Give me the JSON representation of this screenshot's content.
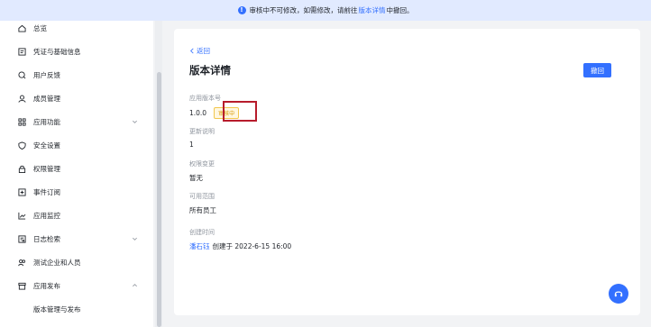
{
  "banner": {
    "prefix": "审核中不可修改，如需修改，请前往",
    "link": "版本详情",
    "suffix": "中撤回。"
  },
  "sidebar": {
    "items": [
      {
        "label": "总览",
        "icon": "home-icon"
      },
      {
        "label": "凭证与基础信息",
        "icon": "credential-icon"
      },
      {
        "label": "用户反馈",
        "icon": "feedback-icon"
      },
      {
        "label": "成员管理",
        "icon": "user-icon"
      },
      {
        "label": "应用功能",
        "icon": "grid-icon",
        "expandable": true
      },
      {
        "label": "安全设置",
        "icon": "shield-icon"
      },
      {
        "label": "权限管理",
        "icon": "lock-icon"
      },
      {
        "label": "事件订阅",
        "icon": "subscribe-icon"
      },
      {
        "label": "应用监控",
        "icon": "chart-icon"
      },
      {
        "label": "日志检索",
        "icon": "log-icon",
        "expandable": true
      },
      {
        "label": "测试企业和人员",
        "icon": "test-users-icon"
      },
      {
        "label": "应用发布",
        "icon": "publish-icon",
        "expanded": true
      },
      {
        "label": "版本管理与发布",
        "sub": true,
        "selected": true
      }
    ]
  },
  "detail": {
    "back_label": "返回",
    "title": "版本详情",
    "withdraw_label": "撤回",
    "version_label": "应用版本号",
    "version_value": "1.0.0",
    "status_badge": "审核中",
    "notes_label": "更新说明",
    "notes_value": "1",
    "permission_label": "权限变更",
    "permission_value": "暂无",
    "scope_label": "可用范围",
    "scope_value": "所有员工",
    "created_label": "创建时间",
    "creator": "潘石钰",
    "created_text": "创建于 2022-6-15 16:00"
  },
  "colors": {
    "accent": "#3370ff",
    "banner_bg": "#e1eaff",
    "badge_text": "#d99904",
    "highlight": "#b71c2c"
  }
}
